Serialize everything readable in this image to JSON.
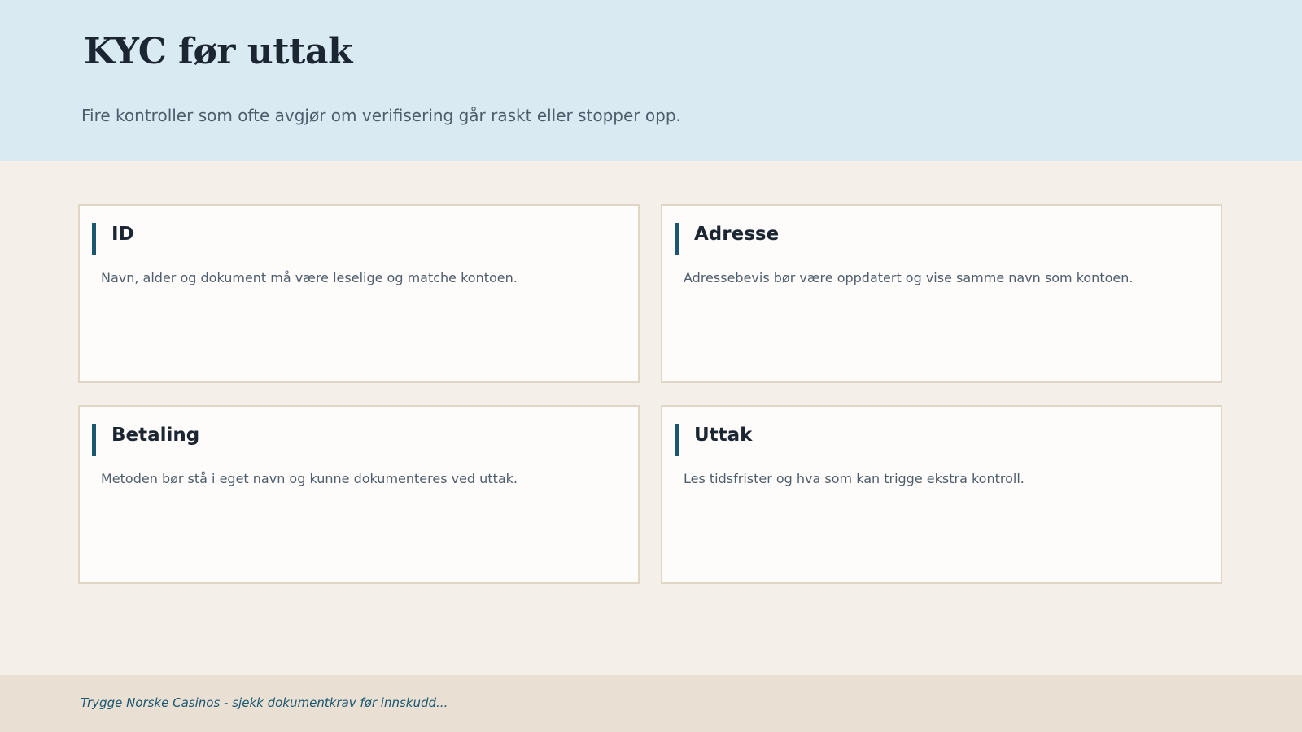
{
  "header": {
    "title": "KYC før uttak",
    "subtitle": "Fire kontroller som ofte avgjør om verifisering går raskt eller stopper opp."
  },
  "cards": [
    {
      "title": "ID",
      "text": "Navn, alder og dokument må være leselige og matche kontoen."
    },
    {
      "title": "Adresse",
      "text": "Adressebevis bør være oppdatert og vise samme navn som kontoen."
    },
    {
      "title": "Betaling",
      "text": "Metoden bør stå i eget navn og kunne dokumenteres ved uttak."
    },
    {
      "title": "Uttak",
      "text": "Les tidsfrister og hva som kan trigge ekstra kontroll."
    }
  ],
  "footer": {
    "text": "Trygge Norske Casinos - sjekk dokumentkrav før innskudd..."
  },
  "colors": {
    "header_bg": "#d9eaf2",
    "page_bg": "#f4efe8",
    "card_bg": "#fdfcfa",
    "card_border": "#e0d6c6",
    "accent": "#1a5670",
    "footer_bg": "#e9e0d3"
  }
}
